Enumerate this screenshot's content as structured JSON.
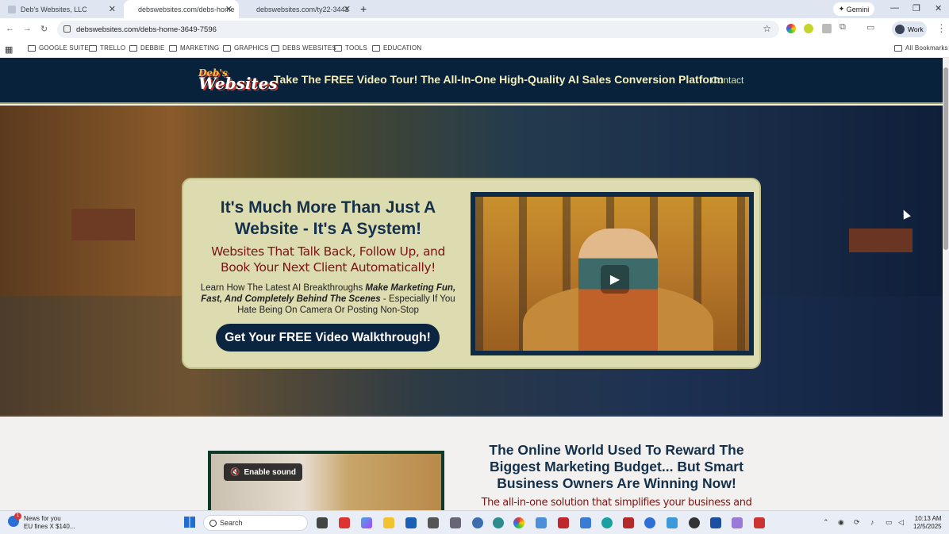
{
  "browser": {
    "tabs": [
      {
        "title": "Deb's Websites, LLC",
        "active": false
      },
      {
        "title": "debswebsites.com/debs-home",
        "active": true
      },
      {
        "title": "debswebsites.com/ty22-3441",
        "active": false
      }
    ],
    "gemini_label": "Gemini",
    "url": "debswebsites.com/debs-home-3649-7596",
    "profile_label": "Work",
    "bookmarks": [
      "GOOGLE SUITE",
      "TRELLO",
      "DEBBIE",
      "MARKETING",
      "GRAPHICS",
      "DEBS WEBSITES",
      "TOOLS",
      "EDUCATION"
    ],
    "all_bookmarks": "All Bookmarks"
  },
  "site": {
    "logo_top": "Deb's",
    "logo_bottom": "Websites",
    "tagline": "Take The FREE Video Tour! The All-In-One High-Quality AI Sales Conversion Platform",
    "contact": "Contact"
  },
  "hero": {
    "headline": "It's Much More Than Just A Website - It's A System!",
    "subheadline": "Websites That Talk Back, Follow Up, and Book Your Next Client Automatically!",
    "body_lead": "Learn How The Latest AI Breakthroughs ",
    "body_emph": "Make Marketing Fun, Fast, And Completely Behind The Scenes",
    "body_tail": " - Especially If You Hate Being On Camera Or Posting Non-Stop",
    "cta": "Get Your FREE Video Walkthrough!"
  },
  "section2": {
    "sound_label": "Enable sound",
    "headline": "The Online World Used To Reward The Biggest Marketing Budget... But Smart Business Owners Are Winning Now!",
    "text": "The all-in-one solution that simplifies your business and"
  },
  "taskbar": {
    "news_count": "1",
    "news_title": "News for you",
    "news_sub": "EU fines X $140...",
    "search_placeholder": "Search",
    "time": "10:13 AM",
    "date": "12/5/2025"
  }
}
